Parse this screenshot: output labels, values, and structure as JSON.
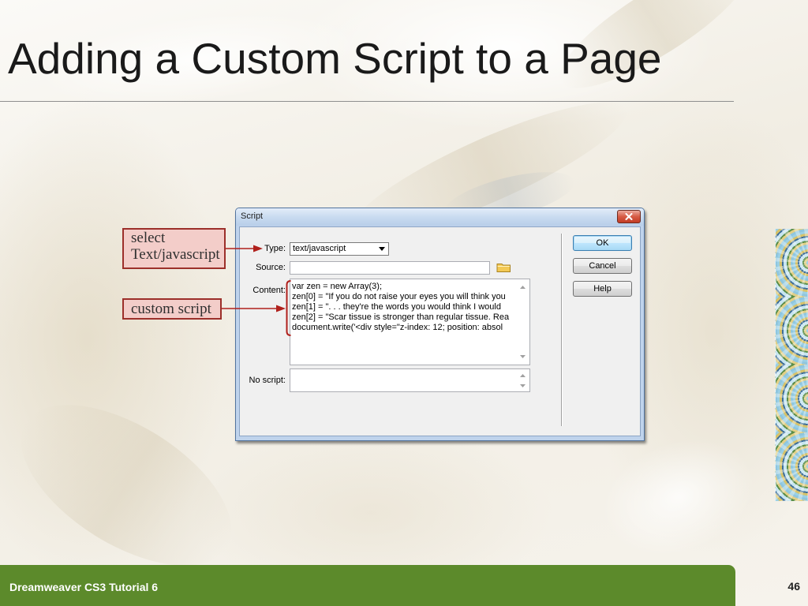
{
  "slide": {
    "title": "Adding a Custom Script to a Page",
    "footer_text": "Dreamweaver CS3 Tutorial 6",
    "page_number": "46"
  },
  "callouts": [
    {
      "lines": [
        "select",
        "Text/javascript"
      ]
    },
    {
      "lines": [
        "custom script"
      ]
    }
  ],
  "dialog": {
    "title": "Script",
    "fields": {
      "type": {
        "label": "Type:",
        "value": "text/javascript"
      },
      "source": {
        "label": "Source:",
        "value": ""
      },
      "content": {
        "label": "Content:",
        "lines": [
          "var zen = new Array(3);",
          "zen[0] = \"If you do not raise your eyes you will think you",
          "zen[1] = \". . . they're the words you would think I would",
          "zen[2] = \"Scar tissue is stronger than regular tissue. Rea",
          "document.write('<div style=\"z-index: 12; position: absol"
        ]
      },
      "no_script": {
        "label": "No script:",
        "value": ""
      }
    },
    "buttons": {
      "ok": "OK",
      "cancel": "Cancel",
      "help": "Help"
    }
  },
  "icons": {
    "close_button": "close-icon",
    "type_dropdown": "chevron-down-icon",
    "source_browse": "folder-icon",
    "scroll_up": "scroll-up-icon",
    "scroll_down": "scroll-down-icon"
  },
  "colors": {
    "footer_bar": "#5c8a2b",
    "callout_fill": "#f3cdc9",
    "callout_border": "#9c2f2a",
    "annotation_red": "#b0201c",
    "dialog_titlebar": "#c5d8ef",
    "default_button_border": "#3c7fb1"
  }
}
